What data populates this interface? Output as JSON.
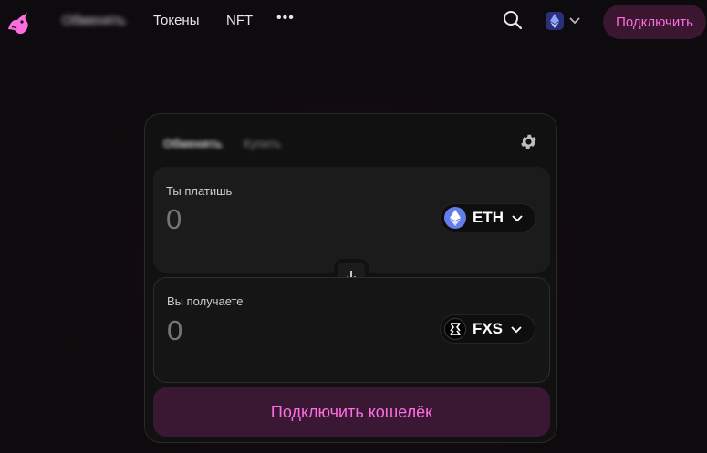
{
  "nav": {
    "logo_icon": "uniswap-unicorn-icon",
    "items": [
      "Обменять",
      "Токены",
      "NFT"
    ],
    "more_label": "•••",
    "search_icon": "search-icon",
    "network_icon": "ethereum-icon",
    "connect_label": "Подключить"
  },
  "swap": {
    "tabs": [
      "Обменять",
      "Купить"
    ],
    "settings_icon": "gear-icon",
    "pay": {
      "label": "Ты платишь",
      "amount_placeholder": "0",
      "token": "ETH"
    },
    "receive": {
      "label": "Вы получаете",
      "amount_placeholder": "0",
      "token": "FXS"
    },
    "switch_icon": "arrow-down-icon",
    "connect_wallet_label": "Подключить кошелёк"
  },
  "colors": {
    "accent": "#fb6ee0",
    "accent_bg": "#3a1833",
    "background": "#0d0b0d",
    "card": "#121112"
  }
}
